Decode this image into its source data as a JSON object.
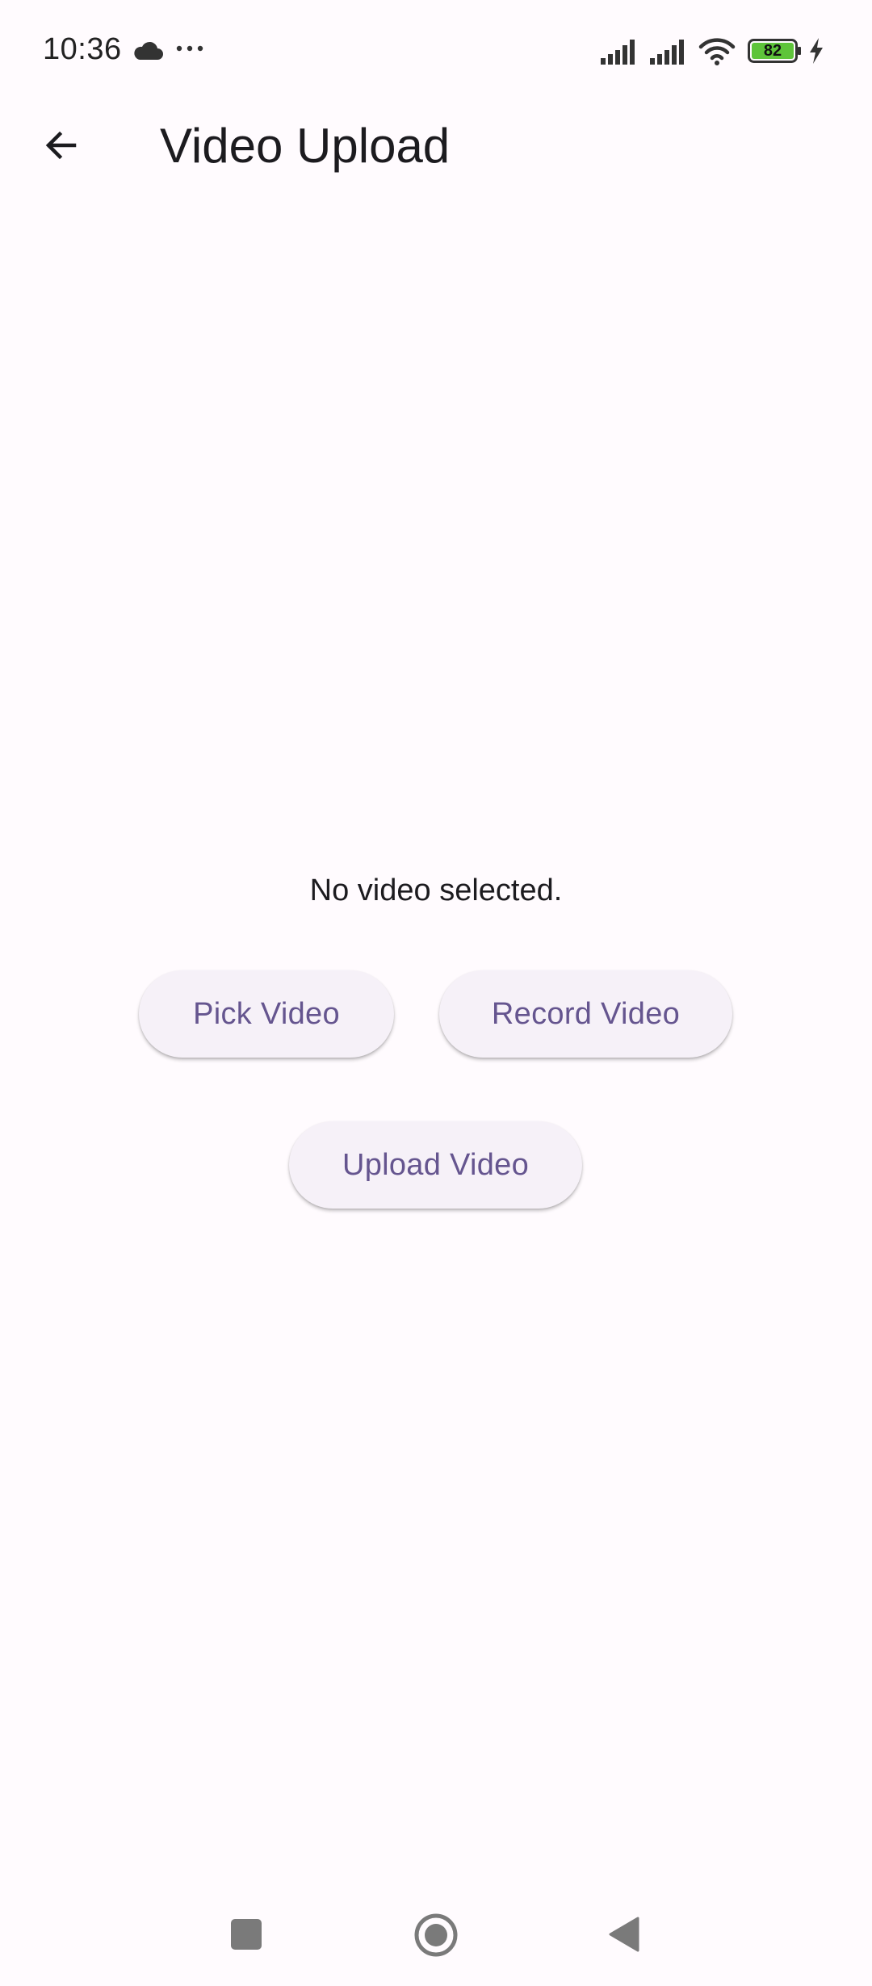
{
  "status_bar": {
    "time": "10:36",
    "battery_level": "82",
    "icons": [
      "cloud-icon",
      "more-dots-icon",
      "cell-signal-icon",
      "cell-signal-icon",
      "wifi-icon",
      "battery-icon",
      "charging-bolt-icon"
    ],
    "battery_color": "#5ec43a"
  },
  "app_bar": {
    "title": "Video Upload",
    "back_icon": "arrow-back-icon"
  },
  "main": {
    "status_text": "No video selected.",
    "pick_label": "Pick Video",
    "record_label": "Record Video",
    "upload_label": "Upload Video"
  },
  "nav_bar": {
    "icons": [
      "recents-square-icon",
      "home-circle-icon",
      "back-triangle-icon"
    ]
  },
  "colors": {
    "background": "#fffbfe",
    "button_bg": "#f6f1f8",
    "button_text": "#65558f",
    "nav_icon": "#7a7a7a"
  }
}
